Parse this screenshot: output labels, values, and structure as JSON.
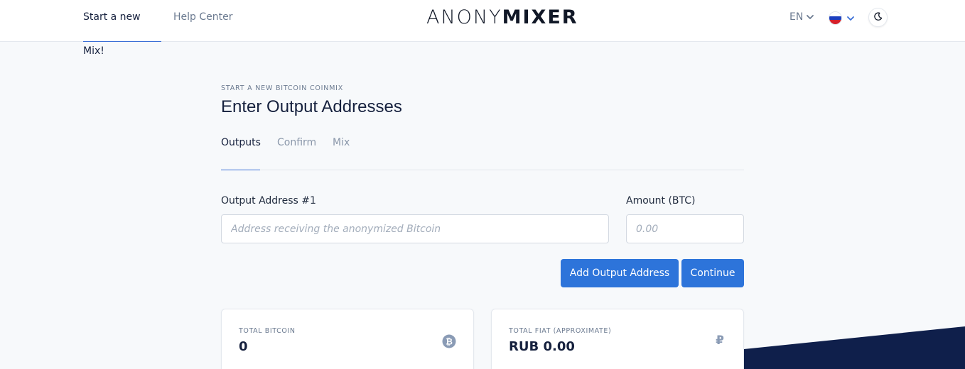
{
  "header": {
    "nav": [
      {
        "label": "Start a new Mix!",
        "active": true
      },
      {
        "label": "Help Center",
        "active": false
      }
    ],
    "logo": {
      "light": "ANONY",
      "bold": "MIXER"
    },
    "language": "EN",
    "currency_flag": "russia-flag-icon",
    "theme_icon": "moon-icon"
  },
  "main": {
    "eyebrow": "START A NEW BITCOIN COINMIX",
    "title": "Enter Output Addresses",
    "tabs": [
      {
        "label": "Outputs",
        "active": true
      },
      {
        "label": "Confirm",
        "active": false
      },
      {
        "label": "Mix",
        "active": false
      }
    ],
    "form": {
      "address_label": "Output Address #1",
      "address_placeholder": "Address receiving the anonymized Bitcoin",
      "address_value": "",
      "amount_label": "Amount (BTC)",
      "amount_placeholder": "0.00",
      "amount_value": ""
    },
    "buttons": {
      "add": "Add Output Address",
      "continue": "Continue"
    },
    "cards": [
      {
        "label": "TOTAL BITCOIN",
        "value": "0",
        "icon": "bitcoin-icon"
      },
      {
        "label": "TOTAL FIAT (APPROXIMATE)",
        "value": "RUB 0.00",
        "icon": "ruble-icon"
      }
    ]
  },
  "colors": {
    "accent": "#2d74da",
    "text": "#16213e",
    "muted": "#6b7a90",
    "navy_deco": "#0f1f4b"
  }
}
